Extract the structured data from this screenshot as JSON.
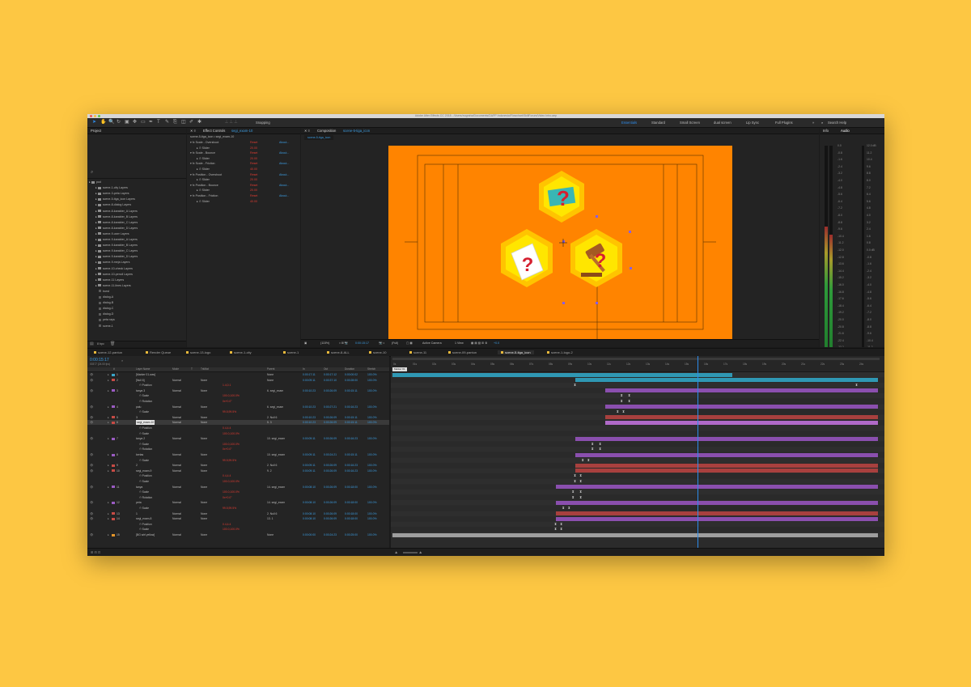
{
  "colors": {
    "background": "#FDC743",
    "canvas": "#FF8400",
    "hex_outer": "#FFC400",
    "hex_inner": "#FFE600",
    "accent": "#2D8CEB"
  },
  "titlebar": {
    "title": "Adobe After Effects CC 2018 - /Users/nugraha/Documents/DAPP Indonesia/Flowchart/SkillForum/Video Intro.aep"
  },
  "toolbar": {
    "snapping": "Snapping",
    "workspaces": [
      "Essentials",
      "Standard",
      "Small Screen",
      "dual screen",
      "Lip Sync",
      "Full Plugins"
    ],
    "search": "Search Help"
  },
  "project": {
    "title": "Project",
    "bpc": "8 bpc",
    "items": [
      {
        "name": "pod",
        "type": "folder"
      },
      {
        "name": "scene-1-city Layers",
        "type": "folder"
      },
      {
        "name": "scene-3-peta Layers",
        "type": "folder"
      },
      {
        "name": "scene-5-tiga_icon Layers",
        "type": "folder"
      },
      {
        "name": "scene-8-dialog Layers",
        "type": "folder"
      },
      {
        "name": "scene-8-karakter_A Layers",
        "type": "folder"
      },
      {
        "name": "scene-8-karakter_B Layers",
        "type": "folder"
      },
      {
        "name": "scene-8-karakter_C Layers",
        "type": "folder"
      },
      {
        "name": "scene-8-karakter_D Layers",
        "type": "folder"
      },
      {
        "name": "scene-9-user Layers",
        "type": "folder"
      },
      {
        "name": "scene-9-karakter_A Layers",
        "type": "folder"
      },
      {
        "name": "scene-9-karakter_B Layers",
        "type": "folder"
      },
      {
        "name": "scene-9-karakter_C Layers",
        "type": "folder"
      },
      {
        "name": "scene-9-karakter_D Layers",
        "type": "folder"
      },
      {
        "name": "scene-9-meja Layers",
        "type": "folder"
      },
      {
        "name": "scene-10-check Layers",
        "type": "folder"
      },
      {
        "name": "scene-10-pencil Layers",
        "type": "folder"
      },
      {
        "name": "scene-11 Layers",
        "type": "folder"
      },
      {
        "name": "scene-11-lines Layers",
        "type": "folder"
      },
      {
        "name": "burst",
        "type": "file"
      },
      {
        "name": "dialog-A",
        "type": "file"
      },
      {
        "name": "dialog-B",
        "type": "file"
      },
      {
        "name": "dialog-C",
        "type": "file"
      },
      {
        "name": "dialog-D",
        "type": "file"
      },
      {
        "name": "peta rays",
        "type": "file"
      },
      {
        "name": "scene-1",
        "type": "file"
      }
    ]
  },
  "effects": {
    "title": "Effect Controls",
    "layer": "segi_exam-10",
    "path": "scene-5-tiga_icon • segi_exam-10",
    "reset": "Reset",
    "about": "About...",
    "rows": [
      {
        "name": "Scale - Overshoot",
        "kind": "fx"
      },
      {
        "name": "Slider",
        "kind": "val",
        "value": "20.00"
      },
      {
        "name": "Scale - Bounce",
        "kind": "fx"
      },
      {
        "name": "Slider",
        "kind": "val",
        "value": "20.00"
      },
      {
        "name": "Scale - Friction",
        "kind": "fx"
      },
      {
        "name": "Slider",
        "kind": "val",
        "value": "40.00"
      },
      {
        "name": "Position - Overshoot",
        "kind": "fx"
      },
      {
        "name": "Slider",
        "kind": "val",
        "value": "20.00"
      },
      {
        "name": "Position - Bounce",
        "kind": "fx"
      },
      {
        "name": "Slider",
        "kind": "val",
        "value": "20.00"
      },
      {
        "name": "Position - Friction",
        "kind": "fx"
      },
      {
        "name": "Slider",
        "kind": "val",
        "value": "40.00"
      }
    ]
  },
  "composition": {
    "title": "Composition",
    "name": "scene-5-tiga_icon",
    "tab": "scene-5-tiga_icon",
    "zoom": "(115%)",
    "timecode": "0:00:15:17",
    "quality": "(Full)",
    "camera": "Active Camera",
    "view": "1 View",
    "exposure": "+0.0"
  },
  "right_panel": {
    "tabs": [
      "Info",
      "Audio"
    ],
    "scale_left": [
      "0.0",
      "-0.8",
      "-1.6",
      "-2.4",
      "-3.2",
      "-4.0",
      "-4.8",
      "-5.6",
      "-6.4",
      "-7.2",
      "-8.0",
      "-8.8",
      "-9.6",
      "-10.4",
      "-11.2",
      "-12.0",
      "-12.8",
      "-13.6",
      "-14.4",
      "-15.2",
      "-16.0",
      "-16.8",
      "-17.6",
      "-18.4",
      "-19.2",
      "-20.0",
      "-20.8",
      "-21.6",
      "-22.4",
      "-23.2",
      "-24.0"
    ],
    "scale_right": [
      "12.0 dB",
      "11.2",
      "10.4",
      "9.6",
      "8.8",
      "8.0",
      "7.2",
      "6.4",
      "5.6",
      "4.8",
      "4.0",
      "3.2",
      "2.4",
      "1.6",
      "0.8",
      "0.0 dB",
      "-0.8",
      "-1.6",
      "-2.4",
      "-3.2",
      "-4.0",
      "-4.8",
      "-5.6",
      "-6.4",
      "-7.2",
      "-8.0",
      "-8.8",
      "-9.6",
      "-10.4",
      "-11.2",
      "-12.0 dB"
    ],
    "level": {
      "left": 0.62,
      "right": 0.58
    }
  },
  "comp_tabs": [
    "scene-12-pantun",
    "Render Queue",
    "scene-13-logo",
    "scene-1-city",
    "scene-1",
    "scene-8-ALL",
    "scene-10",
    "scene-11",
    "scene-09-pantun",
    "scene-5-tiga_icon",
    "scene-1-logo-2"
  ],
  "comp_tab_active": 9,
  "timeline": {
    "timecode": "0:00:15:17",
    "fps": "00377 (24.00 fps)",
    "columns": [
      "#",
      "Layer Name",
      "Mode",
      "T",
      "TrkMat",
      "Parent",
      "In",
      "Out",
      "Duration",
      "Stretch"
    ],
    "ruler": [
      "0s",
      "01s",
      "02s",
      "03s",
      "04s",
      "05s",
      "06s",
      "07s",
      "08s",
      "09s",
      "10s",
      "11s",
      "12s",
      "13s",
      "14s",
      "15s",
      "16s",
      "17s",
      "18s",
      "19s",
      "20s",
      "21s",
      "22s",
      "23s",
      "24s"
    ],
    "marker": "Marker 01",
    "playhead": 15.7,
    "duration": 25,
    "layers": [
      {
        "num": "1",
        "name": "[Marker 01.wav]",
        "color": "#3aa5c8",
        "mode": "",
        "parent": "None",
        "in": "0:00:17:11",
        "out": "0:00:17:12",
        "dur": "0:00:00:02",
        "stretch": "100.0%",
        "bar": [
          0,
          17.5
        ],
        "barColor": "#2f98b4",
        "kf": []
      },
      {
        "num": "2",
        "name": "[Null 6]",
        "color": "#c64b45",
        "mode": "Normal",
        "parent": "None",
        "in": "0:00:09:11",
        "out": "0:00:37:10",
        "dur": "0:00:28:00",
        "stretch": "100.0%",
        "bar": [
          9.4,
          25
        ],
        "barColor": "#2f98b4",
        "kf": []
      },
      {
        "num": "",
        "name": "Position",
        "color": "",
        "prop": "1.4,0.1",
        "bar": null,
        "kf": [
          9.4,
          23.9
        ]
      },
      {
        "num": "3",
        "name": "tanya 3",
        "color": "#9a5bc2",
        "mode": "Normal",
        "parent": "6. segi_exam",
        "in": "0:00:10:23",
        "out": "0:00:26:09",
        "dur": "0:00:15:11",
        "stretch": "100.0%",
        "bar": [
          10.95,
          25
        ],
        "barColor": "#8a4fae",
        "kf": []
      },
      {
        "num": "",
        "name": "Scale",
        "color": "",
        "prop": "100.0,100.0%",
        "bar": null,
        "kf": [
          11.8,
          12.2
        ]
      },
      {
        "num": "",
        "name": "Rotation",
        "color": "",
        "prop": "0x+0.0°",
        "bar": null,
        "kf": [
          11.8,
          12.2
        ]
      },
      {
        "num": "4",
        "name": "palu",
        "color": "#9a5bc2",
        "mode": "Normal",
        "parent": "6. segi_exam",
        "in": "0:00:10:23",
        "out": "0:00:27:21",
        "dur": "0:00:16:23",
        "stretch": "100.0%",
        "bar": [
          10.95,
          25
        ],
        "barColor": "#8a4fae",
        "kf": []
      },
      {
        "num": "",
        "name": "Scale",
        "color": "",
        "prop": "99.5,99.5%",
        "bar": null,
        "kf": [
          11.6,
          11.9
        ]
      },
      {
        "num": "5",
        "name": "3",
        "color": "#c64b45",
        "mode": "Normal",
        "parent": "2. Null 6",
        "in": "0:00:10:23",
        "out": "0:00:26:09",
        "dur": "0:00:15:11",
        "stretch": "100.0%",
        "bar": [
          10.95,
          25
        ],
        "barColor": "#a8403e",
        "kf": []
      },
      {
        "num": "6",
        "name": "segi_exam-10",
        "color": "#c64b45",
        "mode": "Normal",
        "parent": "5. 3",
        "in": "0:00:10:23",
        "out": "0:00:26:09",
        "dur": "0:00:15:11",
        "stretch": "100.0%",
        "bar": [
          10.95,
          25
        ],
        "barColor": "#b06ac8",
        "kf": [],
        "selected": true
      },
      {
        "num": "",
        "name": "Position",
        "color": "",
        "prop": "0.4,4.4",
        "bar": null,
        "kf": []
      },
      {
        "num": "",
        "name": "Scale",
        "color": "",
        "prop": "100.0,100.0%",
        "bar": null,
        "kf": []
      },
      {
        "num": "7",
        "name": "tanya 2",
        "color": "#9a5bc2",
        "mode": "Normal",
        "parent": "10. segi_exam",
        "in": "0:00:09:11",
        "out": "0:00:26:09",
        "dur": "0:00:16:23",
        "stretch": "100.0%",
        "bar": [
          9.4,
          25
        ],
        "barColor": "#8a4fae",
        "kf": []
      },
      {
        "num": "",
        "name": "Scale",
        "color": "",
        "prop": "100.0,100.0%",
        "bar": null,
        "kf": [
          10.3,
          10.7
        ]
      },
      {
        "num": "",
        "name": "Rotation",
        "color": "",
        "prop": "0x+0.0°",
        "bar": null,
        "kf": [
          10.3,
          10.7
        ]
      },
      {
        "num": "8",
        "name": "kertas",
        "color": "#9a5bc2",
        "mode": "Normal",
        "parent": "10. segi_exam",
        "in": "0:00:09:11",
        "out": "0:00:24:21",
        "dur": "0:00:15:11",
        "stretch": "100.0%",
        "bar": [
          9.4,
          25
        ],
        "barColor": "#8a4fae",
        "kf": []
      },
      {
        "num": "",
        "name": "Scale",
        "color": "",
        "prop": "99.5,99.5%",
        "bar": null,
        "kf": [
          9.8,
          10.1
        ]
      },
      {
        "num": "9",
        "name": "2",
        "color": "#c64b45",
        "mode": "Normal",
        "parent": "2. Null 6",
        "in": "0:00:09:11",
        "out": "0:00:26:09",
        "dur": "0:00:16:23",
        "stretch": "100.0%",
        "bar": [
          9.4,
          25
        ],
        "barColor": "#a8403e",
        "kf": []
      },
      {
        "num": "10",
        "name": "segi_exam-9",
        "color": "#c64b45",
        "mode": "Normal",
        "parent": "9. 2",
        "in": "0:00:09:11",
        "out": "0:00:26:09",
        "dur": "0:00:16:23",
        "stretch": "100.0%",
        "bar": [
          9.4,
          25
        ],
        "barColor": "#a8403e",
        "kf": []
      },
      {
        "num": "",
        "name": "Position",
        "color": "",
        "prop": "0.4,4.4",
        "bar": null,
        "kf": [
          9.4,
          9.7
        ]
      },
      {
        "num": "",
        "name": "Scale",
        "color": "",
        "prop": "100.0,100.0%",
        "bar": null,
        "kf": [
          9.4,
          9.7
        ]
      },
      {
        "num": "11",
        "name": "tanya",
        "color": "#9a5bc2",
        "mode": "Normal",
        "parent": "14. segi_exam",
        "in": "0:00:08:10",
        "out": "0:00:26:09",
        "dur": "0:00:18:00",
        "stretch": "100.0%",
        "bar": [
          8.4,
          25
        ],
        "barColor": "#8a4fae",
        "kf": []
      },
      {
        "num": "",
        "name": "Scale",
        "color": "",
        "prop": "100.0,100.0%",
        "bar": null,
        "kf": [
          9.3,
          9.7
        ]
      },
      {
        "num": "",
        "name": "Rotation",
        "color": "",
        "prop": "0x+0.0°",
        "bar": null,
        "kf": [
          9.3,
          9.7
        ]
      },
      {
        "num": "12",
        "name": "peta",
        "color": "#9a5bc2",
        "mode": "Normal",
        "parent": "14. segi_exam",
        "in": "0:00:08:10",
        "out": "0:00:26:09",
        "dur": "0:00:18:00",
        "stretch": "100.0%",
        "bar": [
          8.4,
          25
        ],
        "barColor": "#8a4fae",
        "kf": []
      },
      {
        "num": "",
        "name": "Scale",
        "color": "",
        "prop": "99.5,99.5%",
        "bar": null,
        "kf": [
          8.8,
          9.1
        ]
      },
      {
        "num": "13",
        "name": "1",
        "color": "#c64b45",
        "mode": "Normal",
        "parent": "2. Null 6",
        "in": "0:00:08:10",
        "out": "0:00:26:09",
        "dur": "0:00:18:00",
        "stretch": "100.0%",
        "bar": [
          8.4,
          25
        ],
        "barColor": "#a8403e",
        "kf": []
      },
      {
        "num": "14",
        "name": "segi_exam-8",
        "color": "#c64b45",
        "mode": "Normal",
        "parent": "13. 1",
        "in": "0:00:08:10",
        "out": "0:00:26:09",
        "dur": "0:00:18:00",
        "stretch": "100.0%",
        "bar": [
          8.4,
          25
        ],
        "barColor": "#8a4fae",
        "kf": []
      },
      {
        "num": "",
        "name": "Position",
        "color": "",
        "prop": "0.4,4.4",
        "bar": null,
        "kf": [
          8.4,
          8.7
        ]
      },
      {
        "num": "",
        "name": "Scale",
        "color": "",
        "prop": "100.0,100.0%",
        "bar": null,
        "kf": [
          8.4,
          8.7
        ]
      },
      {
        "num": "15",
        "name": "[BG wirl yellow]",
        "color": "#e3952a",
        "mode": "Normal",
        "parent": "None",
        "in": "0:00:00:00",
        "out": "0:00:24:23",
        "dur": "0:00:25:00",
        "stretch": "100.0%",
        "bar": [
          0,
          25
        ],
        "barColor": "#9e9e9e",
        "kf": []
      }
    ]
  }
}
